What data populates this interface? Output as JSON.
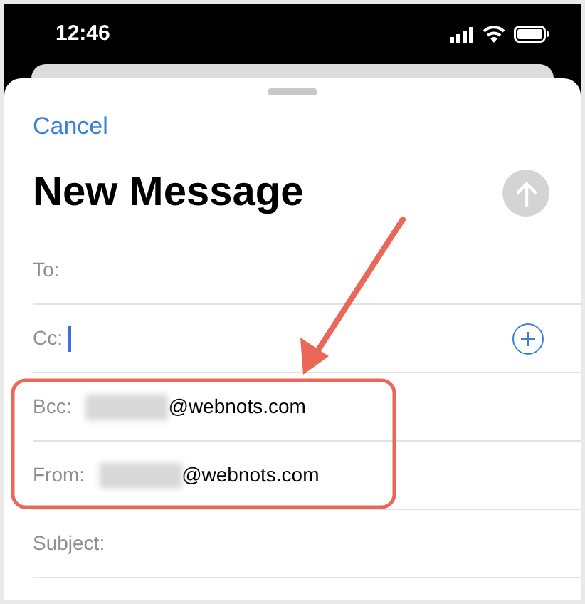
{
  "status_bar": {
    "time": "12:46"
  },
  "compose": {
    "cancel": "Cancel",
    "title": "New Message",
    "send_disabled": true
  },
  "fields": [
    {
      "label": "To:",
      "redacted": false,
      "focused": false,
      "add_button": false
    },
    {
      "label": "Cc:",
      "redacted": false,
      "focused": true,
      "add_button": true
    },
    {
      "label": "Bcc:",
      "value": "@webnots.com",
      "redacted": true,
      "focused": false,
      "add_button": false
    },
    {
      "label": "From:",
      "value": "@webnots.com",
      "redacted": true,
      "focused": false,
      "add_button": false
    },
    {
      "label": "Subject:",
      "redacted": false,
      "focused": false,
      "add_button": false
    }
  ],
  "annotation": {
    "highlight": true
  }
}
